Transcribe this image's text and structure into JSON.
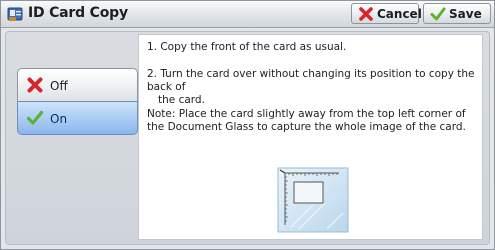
{
  "header": {
    "title": "ID Card Copy",
    "cancel_label": "Cancel",
    "save_label": "Save",
    "icons": {
      "app": "id-card-copy-icon",
      "cancel": "red-x-icon",
      "save": "green-check-icon"
    }
  },
  "options": {
    "items": [
      {
        "label": "Off",
        "icon": "red-x-icon",
        "selected": false
      },
      {
        "label": "On",
        "icon": "green-check-icon",
        "selected": true
      }
    ]
  },
  "instructions": {
    "step1": "1. Copy the front of the card as usual.",
    "step2_line1": "2. Turn the card over without changing its position to copy the back of",
    "step2_line2": "the card.",
    "note": "Note: Place the card slightly away from the top left corner of the Document Glass to capture the whole image of the card."
  },
  "illustration": {
    "icon": "card-on-glass-icon"
  },
  "colors": {
    "accent_blue": "#a9cbf3",
    "cancel_red": "#d6262b",
    "save_green": "#5cb233"
  }
}
